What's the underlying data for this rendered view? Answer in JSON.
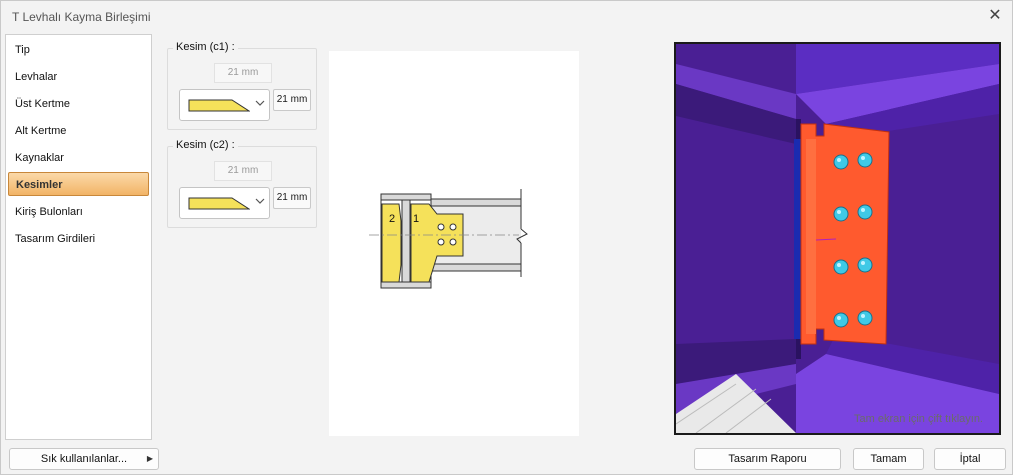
{
  "window": {
    "title": "T Levhalı Kayma Birleşimi",
    "close_glyph": "✕"
  },
  "sidebar": {
    "items": [
      {
        "label": "Tip"
      },
      {
        "label": "Levhalar"
      },
      {
        "label": "Üst Kertme"
      },
      {
        "label": "Alt Kertme"
      },
      {
        "label": "Kaynaklar"
      },
      {
        "label": "Kesimler",
        "active": true
      },
      {
        "label": "Kiriş Bulonları"
      },
      {
        "label": "Tasarım Girdileri"
      }
    ]
  },
  "cuts": [
    {
      "title": "Kesim (c1) :",
      "readonly_value": "21 mm",
      "button_value": "21 mm"
    },
    {
      "title": "Kesim (c2) :",
      "readonly_value": "21 mm",
      "button_value": "21 mm"
    }
  ],
  "drawing": {
    "label_plate_2": "2",
    "label_plate_1": "1"
  },
  "preview3d": {
    "hint": "Tam ekran için çift tıklayın."
  },
  "footer": {
    "favorites_label": "Sık kullanılanlar...",
    "report_label": "Tasarım Raporu",
    "ok_label": "Tamam",
    "cancel_label": "İptal"
  },
  "colors": {
    "accent_active": "#f2b466",
    "plate": "#f5e15a",
    "plate_3d": "#ff5a2e",
    "bolt": "#3fc9e6",
    "beam_3d": "#5a2aa8"
  }
}
